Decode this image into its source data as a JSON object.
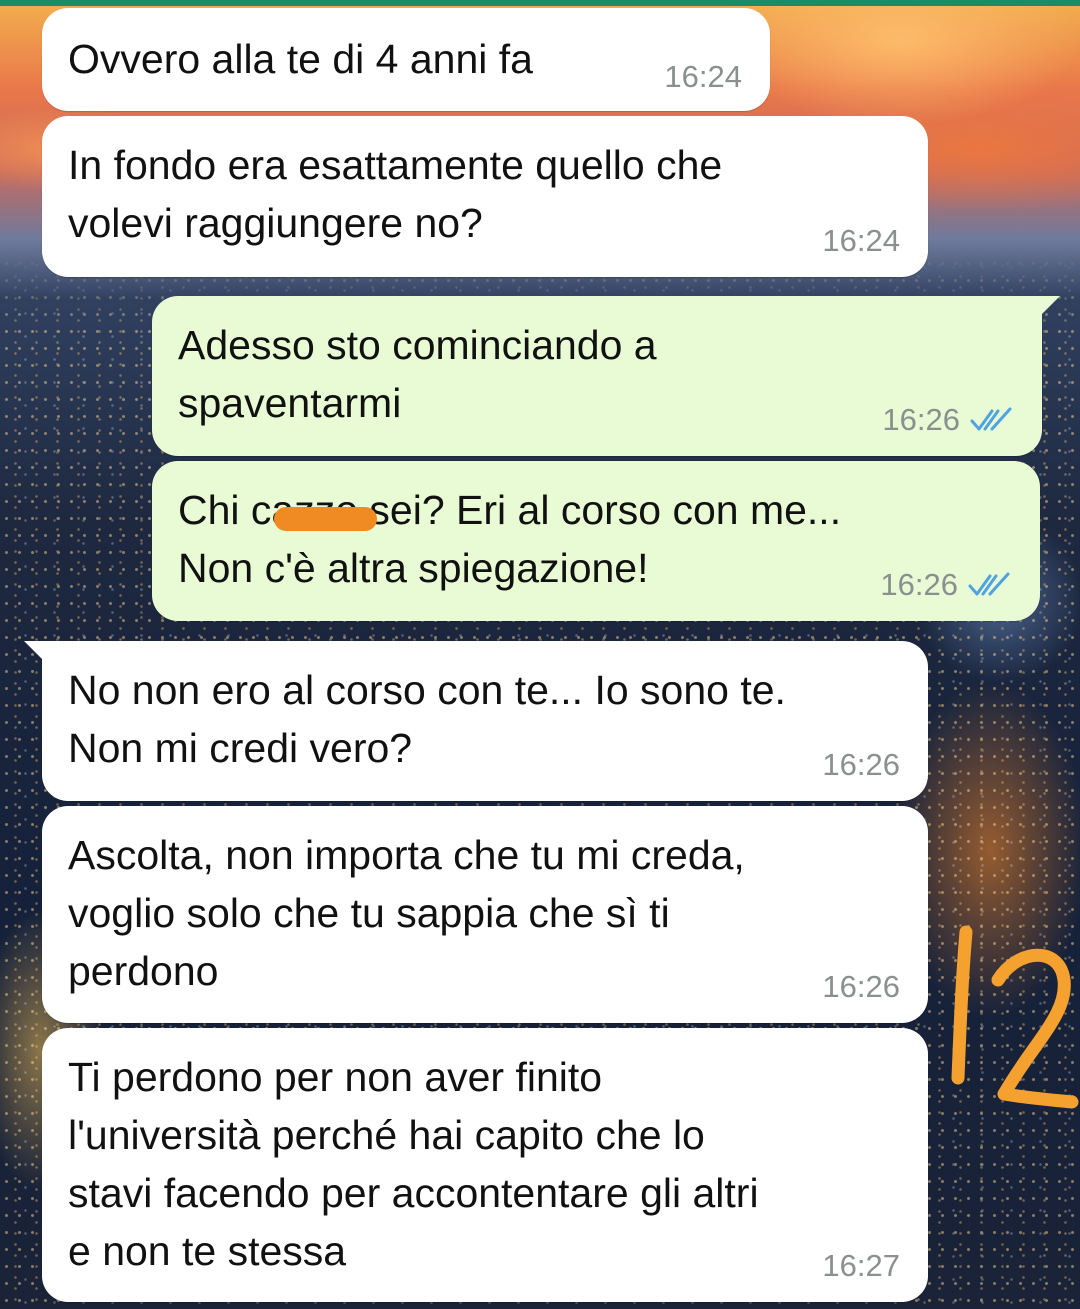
{
  "chat": {
    "messages": [
      {
        "direction": "incoming",
        "text": "Ovvero alla te di 4 anni fa",
        "time": "16:24"
      },
      {
        "direction": "incoming",
        "text": "In fondo era esattamente quello che\nvolevi raggiungere no?",
        "time": "16:24"
      },
      {
        "direction": "outgoing",
        "text": "Adesso sto cominciando a\nspaventarmi",
        "time": "16:26",
        "status_icon": "double-check-read-icon"
      },
      {
        "direction": "outgoing",
        "text": "Chi cazzo sei? Eri al corso con me...\nNon c'è altra spiegazione!",
        "time": "16:26",
        "status_icon": "double-check-read-icon",
        "redacted_word": "cazzo"
      },
      {
        "direction": "incoming",
        "text": "No non ero al corso con te... Io sono te.\nNon mi credi vero?",
        "time": "16:26"
      },
      {
        "direction": "incoming",
        "text": "Ascolta, non importa che tu mi creda,\nvoglio solo che tu sappia che sì ti\nperdono",
        "time": "16:26"
      },
      {
        "direction": "incoming",
        "text": "Ti perdono per non aver finito\nl'università perché hai capito che lo\nstavi facendo per accontentare gli altri\ne non te stessa",
        "time": "16:27"
      }
    ]
  },
  "overlay": {
    "handwritten_number": "12"
  },
  "colors": {
    "incoming_bubble": "#ffffff",
    "outgoing_bubble": "#e8fbd5",
    "read_ticks": "#4fa3e0",
    "redaction_marker": "#f08a23",
    "handwriting": "#f5a12f",
    "timestamp": "#8a8f8f"
  }
}
